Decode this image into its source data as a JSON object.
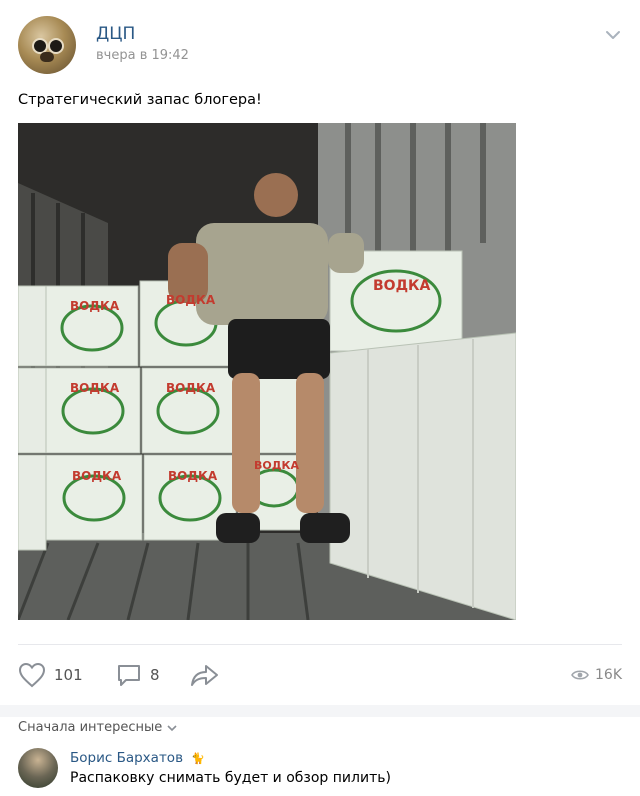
{
  "post": {
    "author": "ДЦП",
    "time": "вчера в 19:42",
    "caption": "Стратегический запас блогера!",
    "photo": {
      "box_label": "ВОДКА"
    },
    "actions": {
      "likes": "101",
      "comments": "8",
      "views": "16K"
    }
  },
  "comments_section": {
    "sort_label": "Сначала интересные",
    "comment": {
      "author": "Борис Бархатов",
      "text": "Распаковку снимать будет и обзор пилить)"
    }
  },
  "colors": {
    "link": "#2a5885",
    "muted": "#939393",
    "box": "#e9efe6",
    "box_green": "#3b8a3c"
  }
}
